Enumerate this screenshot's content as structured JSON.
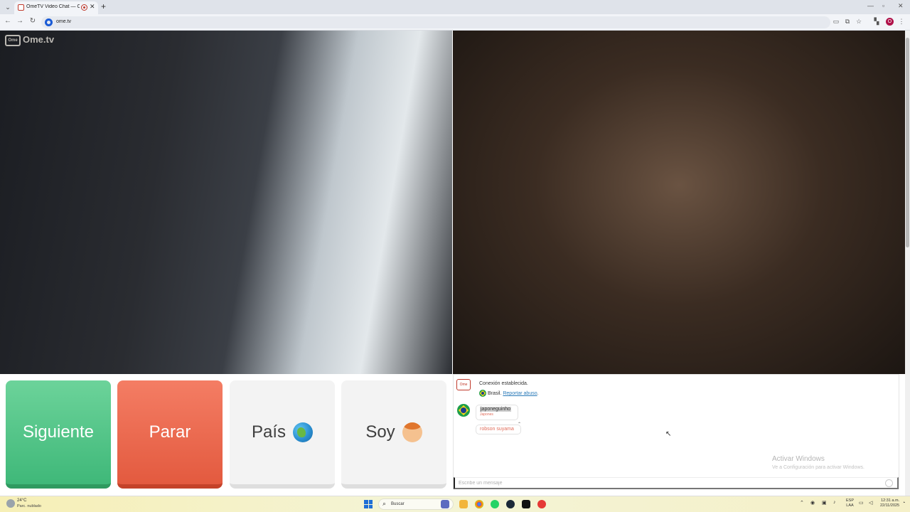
{
  "browser": {
    "tab_title": "OmeTV Video Chat — Ome",
    "url": "ome.tv",
    "profile_initial": "O"
  },
  "logo": {
    "text": "Ome.tv",
    "tv_label": "Ome"
  },
  "controls": {
    "next_label": "Siguiente",
    "stop_label": "Parar",
    "country_label": "País",
    "country_icon": "globe-icon",
    "gender_label": "Soy",
    "gender_icon": "person-icon"
  },
  "chat": {
    "ome_avatar_label": "Ome",
    "connected_text": "Conexión establecida.",
    "country": "Brasil.",
    "report_link": "Reportar abuso",
    "report_suffix": ".",
    "messages": [
      {
        "name": "japoneguinho",
        "sub": "Japones"
      },
      {
        "text": "robson suyama",
        "mark": "⌃"
      }
    ],
    "input_placeholder": "Escribe un mensaje",
    "watermark_title": "Activar Windows",
    "watermark_sub": "Ve a Configuración para activar Windows."
  },
  "taskbar": {
    "weather_temp": "24°C",
    "weather_cond": "Parc. nublado",
    "search_label": "Buscar",
    "lang_line1": "ESP",
    "lang_line2": "LAA",
    "time": "12:31 a.m.",
    "date": "22/11/2025"
  },
  "colors": {
    "next": "#4ac785",
    "stop": "#ea6a4f",
    "neutral": "#f3f3f3",
    "link": "#2a7ab8"
  }
}
